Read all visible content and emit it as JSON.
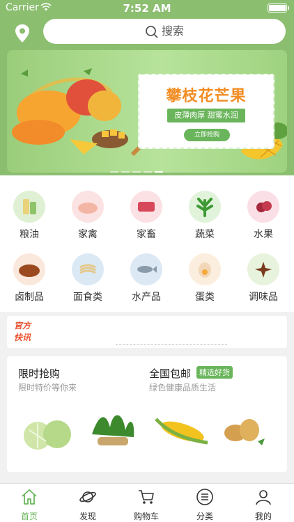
{
  "status_bar": {
    "carrier": "Carrier",
    "time": "7:52 AM"
  },
  "header": {
    "search_label": "搜索"
  },
  "banner": {
    "title": "攀枝花芒果",
    "subtitle": "皮薄肉厚 甜蜜水润",
    "cta": "立即抢购",
    "dots": 5,
    "active_dot": 4
  },
  "categories": [
    {
      "label": "粮油",
      "icon": "grain-oil-icon"
    },
    {
      "label": "家禽",
      "icon": "poultry-icon"
    },
    {
      "label": "家畜",
      "icon": "livestock-meat-icon"
    },
    {
      "label": "蔬菜",
      "icon": "vegetable-icon"
    },
    {
      "label": "水果",
      "icon": "fruit-icon"
    },
    {
      "label": "卤制品",
      "icon": "braised-food-icon"
    },
    {
      "label": "面食类",
      "icon": "noodle-icon"
    },
    {
      "label": "水产品",
      "icon": "seafood-icon"
    },
    {
      "label": "蛋类",
      "icon": "egg-icon"
    },
    {
      "label": "调味品",
      "icon": "seasoning-icon"
    }
  ],
  "news": {
    "logo_line1": "官方",
    "logo_line2": "快讯"
  },
  "promo": {
    "left": {
      "title": "限时抢购",
      "subtitle": "限时特价等你来"
    },
    "right": {
      "title": "全国包邮",
      "badge": "精选好货",
      "subtitle": "绿色健康品质生活"
    }
  },
  "tabs": [
    {
      "label": "首页",
      "icon": "home-icon",
      "active": true
    },
    {
      "label": "发现",
      "icon": "planet-icon",
      "active": false
    },
    {
      "label": "购物车",
      "icon": "cart-icon",
      "active": false
    },
    {
      "label": "分类",
      "icon": "list-icon",
      "active": false
    },
    {
      "label": "我的",
      "icon": "user-icon",
      "active": false
    }
  ],
  "colors": {
    "brand_green": "#8cbe70",
    "accent_green": "#6ab55b",
    "orange": "#f28d23"
  }
}
